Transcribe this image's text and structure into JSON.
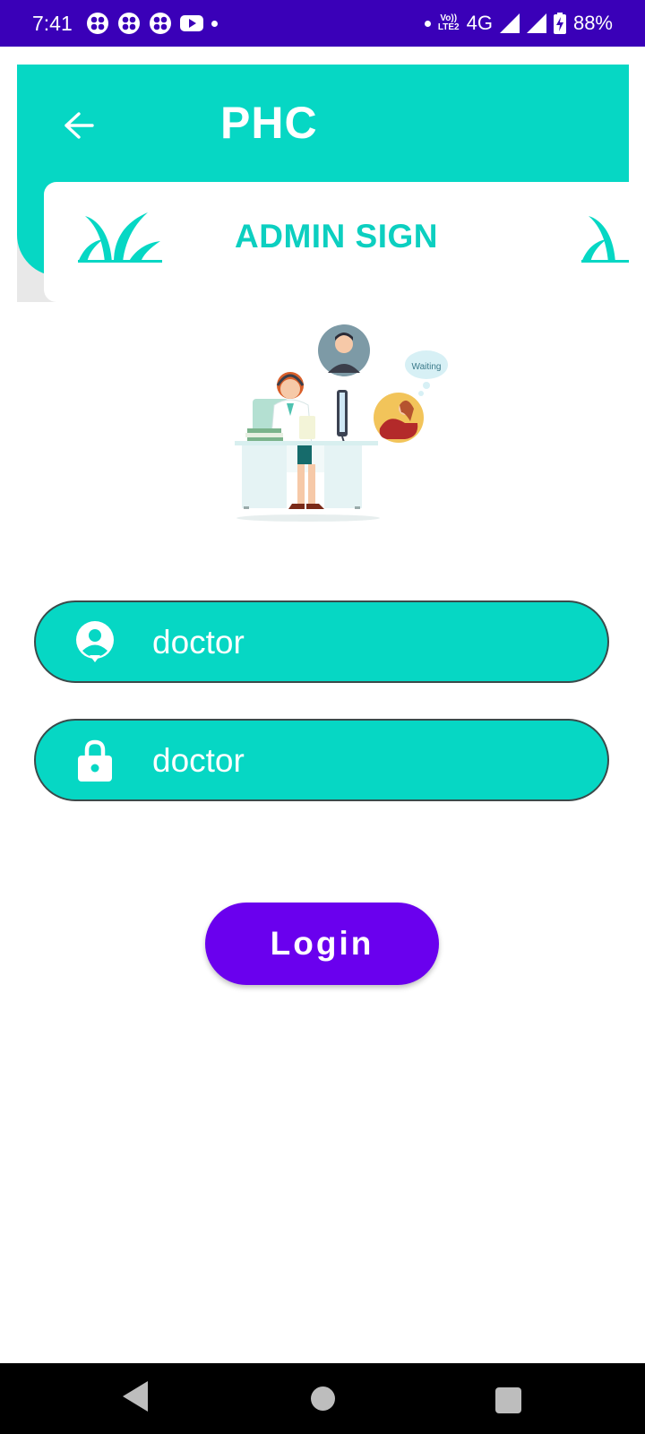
{
  "status_bar": {
    "time": "7:41",
    "left_icons": [
      "fan-app-icon",
      "fan-app-icon",
      "fan-app-icon",
      "youtube-icon",
      "dot"
    ],
    "volte_top": "Vo))",
    "volte_bottom": "LTE2",
    "network": "4G",
    "battery": "88%"
  },
  "header": {
    "title": "PHC",
    "back_icon": "arrow-left-icon"
  },
  "card": {
    "title": "ADMIN SIGN"
  },
  "illustration": {
    "bubble_text": "Waiting"
  },
  "form": {
    "username_value": "doctor",
    "password_value": "doctor",
    "username_icon": "user-account-icon",
    "password_icon": "lock-icon"
  },
  "login": {
    "label": "Login"
  },
  "colors": {
    "status_bar": "#3a00b8",
    "accent": "#06d7c4",
    "button": "#6a00ee",
    "card_title": "#0ccfc0"
  },
  "nav_bar": {
    "icons": [
      "back-triangle-icon",
      "home-circle-icon",
      "recents-square-icon"
    ]
  }
}
